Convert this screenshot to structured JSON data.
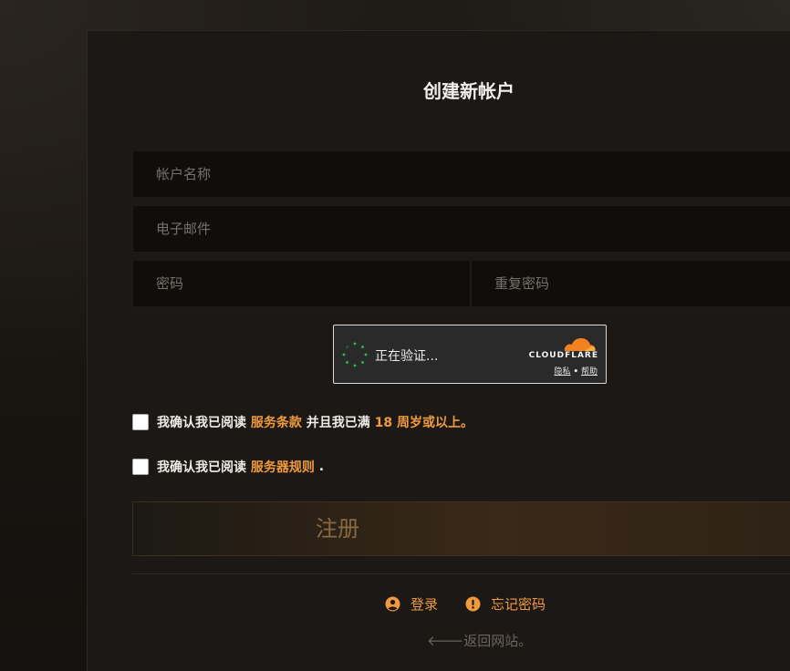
{
  "form": {
    "title": "创建新帐户",
    "account_placeholder": "帐户名称",
    "email_placeholder": "电子邮件",
    "password_placeholder": "密码",
    "repeat_password_placeholder": "重复密码"
  },
  "captcha": {
    "status": "正在验证...",
    "brand": "CLOUDFLARE",
    "privacy": "隐私",
    "separator": "•",
    "help": "帮助"
  },
  "agreements": {
    "terms_prefix": "我确认我已阅读",
    "terms_link": "服务条款",
    "terms_middle": "并且我已满",
    "terms_age": "18 周岁或以上。",
    "rules_prefix": "我确认我已阅读",
    "rules_link": "服务器规则",
    "rules_suffix": "."
  },
  "actions": {
    "register_label": "注册",
    "login_label": "登录",
    "forgot_label": "忘记密码",
    "back_label": "返回网站。",
    "back_arrow": "🡐"
  },
  "colors": {
    "accent": "#f09a3e",
    "cloudflare_orange": "#f48120",
    "spinner_green": "#2ec04f"
  },
  "icons": {
    "login": "user-circle-icon",
    "forgot": "exclamation-circle-icon",
    "back": "arrow-left-icon"
  }
}
